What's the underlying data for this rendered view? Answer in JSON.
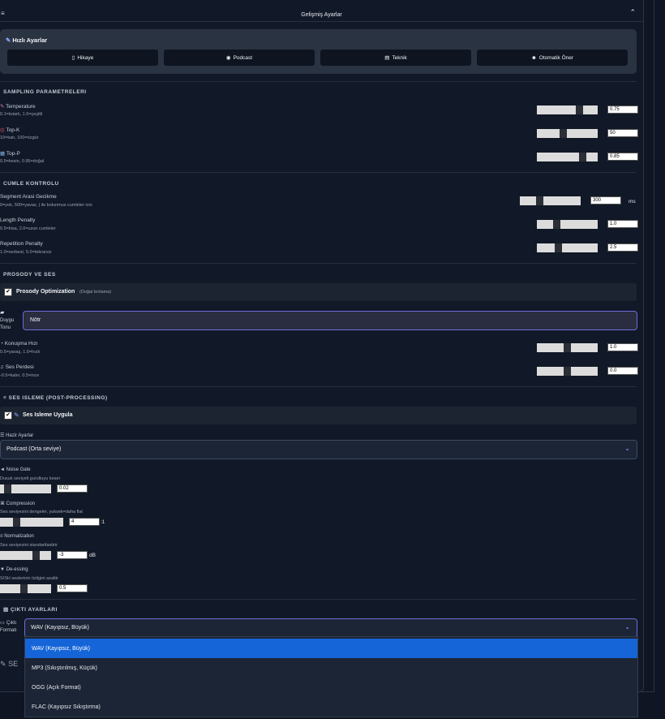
{
  "header": {
    "title": "Gelişmiş Ayarlar",
    "icon": "sliders-icon",
    "collapse_icon": "chevron-up-icon"
  },
  "quick": {
    "title": "Hızlı Ayarlar",
    "buttons": [
      {
        "label": "Hikaye",
        "icon": "page-icon"
      },
      {
        "label": "Podcast",
        "icon": "mic-icon"
      },
      {
        "label": "Teknik",
        "icon": "document-icon"
      },
      {
        "label": "Otomatik Öner",
        "icon": "robot-icon"
      }
    ]
  },
  "sampling": {
    "title": "SAMPLING PARAMETRELERI",
    "rows": [
      {
        "label": "Temperature",
        "desc": "0.1=tutarlı, 1.0=çeşitli",
        "value": "0.75",
        "icon": "thermometer-icon"
      },
      {
        "label": "Top-K",
        "desc": "10=katı, 100=özgür",
        "value": "50",
        "icon": "target-icon"
      },
      {
        "label": "Top-P",
        "desc": "0.5=kesin, 0.95=doğal",
        "value": "0.85",
        "icon": "chart-icon"
      }
    ]
  },
  "cumle": {
    "title": "CUMLE KONTROLU",
    "rows": [
      {
        "label": "Segment Arasi Gecikme",
        "desc": "0=yok, 500=yavas, | ile bolunmus cumleler icin",
        "value": "300",
        "unit": "ms"
      },
      {
        "label": "Length Penalty",
        "desc": "0.5=kisa, 2.0=uzun cumleler",
        "value": "1.0"
      },
      {
        "label": "Repetition Penalty",
        "desc": "1.0=serbest, 5.0=tekrarsiz",
        "value": "2.5"
      }
    ]
  },
  "prosody": {
    "title": "PROSODY VE SES",
    "opt_label": "Prosody Optimization",
    "opt_note": "(Doğal tonlama)",
    "checked": "✔",
    "emotion_label_1": "Duygu",
    "emotion_label_2": "Tonu",
    "emotion_value": "Nötr",
    "rows": [
      {
        "label": "Konuşma Hızı",
        "desc": "0.5=yavaş, 1.5=hızlı",
        "value": "1.0"
      },
      {
        "label": "Ses Perdesi",
        "desc": "-0.5=kalın, 0.5=ince",
        "value": "0.0"
      }
    ]
  },
  "ses": {
    "title": "SES ISLEME (POST-PROCESSING)",
    "apply_label": "Ses Isleme Uygula",
    "checked": "✔",
    "preset_label": "Hazir Ayarlar",
    "preset_value": "Podcast (Orta seviye)",
    "rows": [
      {
        "label": "Noise Gate",
        "desc": "Dusuk seviyeli gurultuyu keser",
        "value": "0.02",
        "unit": ""
      },
      {
        "label": "Compression",
        "desc": "Ses seviyesini dengeler, yuksek=daha flat",
        "value": "4",
        "unit": ":1"
      },
      {
        "label": "Normalization",
        "desc": "Ses seviyesini standartlastirir",
        "value": "-3",
        "unit": "dB"
      },
      {
        "label": "De-essing",
        "desc": "S/SH seslerinin tizligini azaltir",
        "value": "0.5",
        "unit": ""
      }
    ]
  },
  "cikti": {
    "title": "ÇIKTI AYARLARI",
    "label_1": "Çıktı",
    "label_2": "Formatı",
    "value": "WAV (Kayıpsız, Büyük)",
    "options": [
      "WAV (Kayıpsız, Büyük)",
      "MP3 (Sıkıştırılmış, Küçük)",
      "OGG (Açık Format)",
      "FLAC (Kayıpsız Sıkıştırma)"
    ],
    "selected_index": 0
  },
  "bottom": {
    "label": "SE"
  }
}
